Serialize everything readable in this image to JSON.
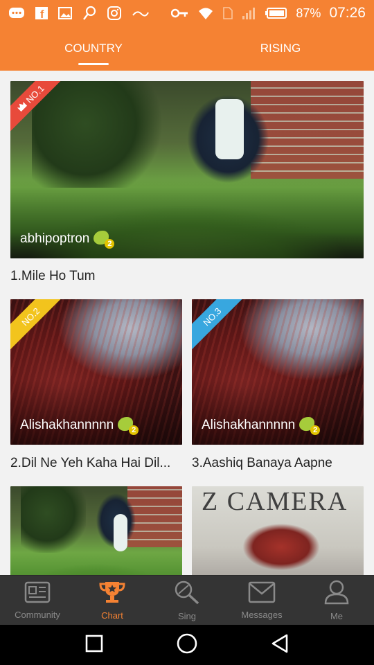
{
  "status_bar": {
    "battery": "87%",
    "time": "07:26"
  },
  "tabs": [
    {
      "label": "COUNTRY",
      "active": true
    },
    {
      "label": "RISING",
      "active": false
    }
  ],
  "cards": [
    {
      "rank": "NO.1",
      "user": "abhipoptron",
      "level": "2",
      "title": "1.Mile Ho Tum"
    },
    {
      "rank": "NO.2",
      "user": "Alishakhannnnn",
      "level": "2",
      "title": "2.Dil Ne Yeh Kaha Hai Dil..."
    },
    {
      "rank": "NO.3",
      "user": "Alishakhannnnn",
      "level": "2",
      "title": "3.Aashiq Banaya Aapne"
    },
    {
      "rank": "",
      "user": "",
      "level": "",
      "title": ""
    },
    {
      "rank": "",
      "user": "",
      "level": "",
      "title": "",
      "overlay_text": "Z CAMERA"
    }
  ],
  "bottom_nav": [
    {
      "label": "Community",
      "icon": "community-icon",
      "active": false
    },
    {
      "label": "Chart",
      "icon": "trophy-icon",
      "active": true
    },
    {
      "label": "Sing",
      "icon": "sing-icon",
      "active": false
    },
    {
      "label": "Messages",
      "icon": "envelope-icon",
      "active": false
    },
    {
      "label": "Me",
      "icon": "person-icon",
      "active": false
    }
  ],
  "colors": {
    "accent": "#f58233",
    "rank1": "#e84a3b",
    "rank2": "#f2c41d",
    "rank3": "#38a7df",
    "nav_bg": "#343434"
  }
}
